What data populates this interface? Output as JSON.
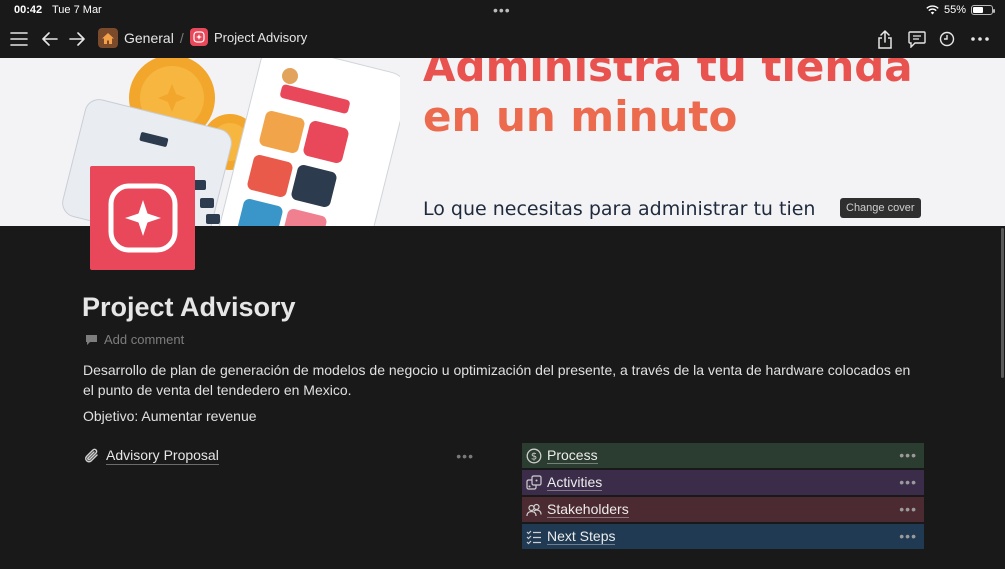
{
  "status": {
    "time": "00:42",
    "date": "Tue 7 Mar",
    "battery": "55%",
    "battery_level": 0.55
  },
  "nav": {
    "breadcrumb": [
      {
        "label": "General",
        "icon": "home-icon"
      },
      {
        "separator": "/"
      },
      {
        "label": "Project Advisory",
        "icon": "sparkle-icon"
      }
    ]
  },
  "cover": {
    "headline_1": "Administra tu tienda",
    "headline_2": "en un minuto",
    "tagline": "Lo que necesitas para administrar tu tien",
    "change_cover": "Change cover"
  },
  "page": {
    "title": "Project Advisory",
    "add_comment": "Add comment",
    "description": "Desarrollo de plan de generación de modelos de negocio u optimización del presente, a través de la venta de hardware colocados en el punto de venta del tendedero en Mexico.",
    "objective": "Objetivo: Aumentar revenue"
  },
  "links": [
    {
      "label": "Advisory Proposal",
      "icon": "paperclip-icon"
    }
  ],
  "cards": [
    {
      "label": "Process",
      "icon": "dollar-circle-icon",
      "color": "#2b3c30"
    },
    {
      "label": "Activities",
      "icon": "dice-icon",
      "color": "#3b2d49"
    },
    {
      "label": "Stakeholders",
      "icon": "people-icon",
      "color": "#4c2a31"
    },
    {
      "label": "Next Steps",
      "icon": "checklist-icon",
      "color": "#1f3a52"
    }
  ],
  "colors": {
    "background": "#191919",
    "accent": "#e8485a"
  }
}
